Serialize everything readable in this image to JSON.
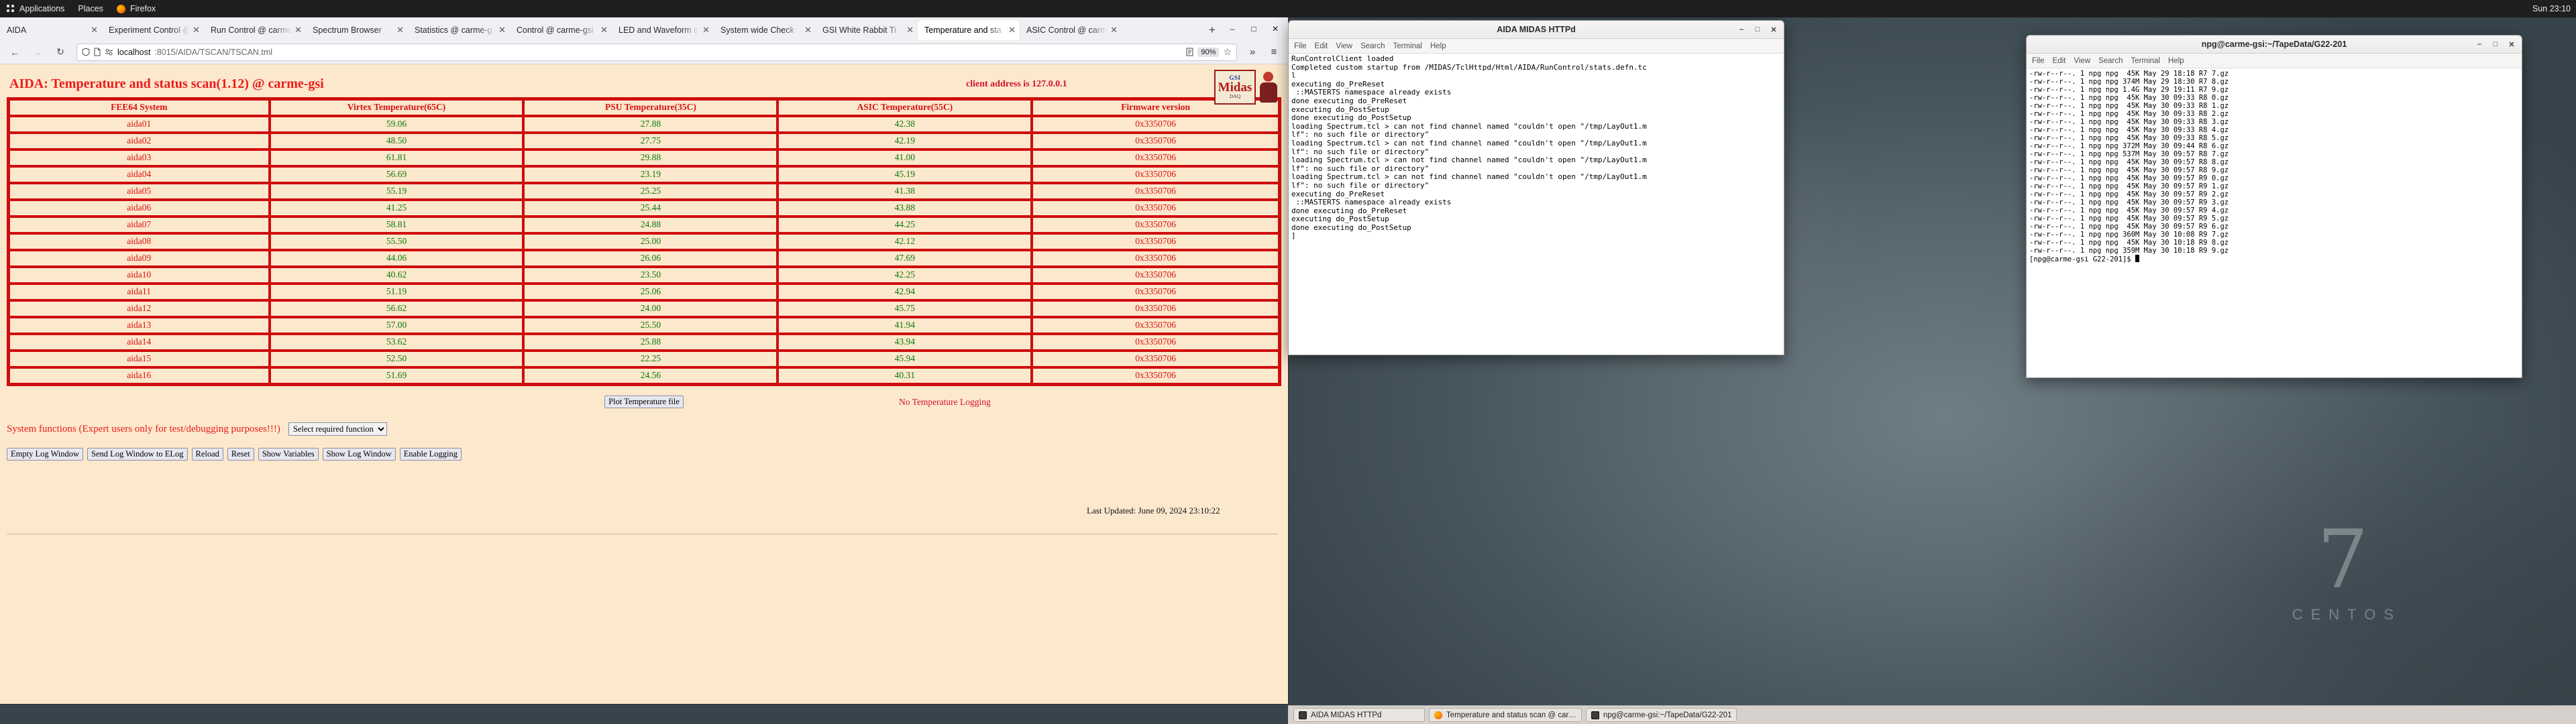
{
  "top_panel": {
    "activities_label": "Applications",
    "places_label": "Places",
    "app_name": "Firefox",
    "clock": "Sun 23:10"
  },
  "browser": {
    "tabs": [
      {
        "label": "AIDA",
        "active": false
      },
      {
        "label": "Experiment Control @",
        "active": false
      },
      {
        "label": "Run Control @ carme",
        "active": false
      },
      {
        "label": "Spectrum Browser",
        "active": false
      },
      {
        "label": "Statistics @ carme-g",
        "active": false
      },
      {
        "label": "Control @ carme-gsi",
        "active": false
      },
      {
        "label": "LED and Waveform c",
        "active": false
      },
      {
        "label": "System wide Check",
        "active": false
      },
      {
        "label": "GSI White Rabbit Ti",
        "active": false
      },
      {
        "label": "Temperature and sta",
        "active": true
      },
      {
        "label": "ASIC Control @ carm",
        "active": false
      }
    ],
    "tab_close_glyph": "✕",
    "newtab_glyph": "+",
    "window_controls": {
      "minimize": "–",
      "maximize": "□",
      "close": "✕"
    },
    "nav": {
      "back": "←",
      "forward": "→",
      "reload": "↻"
    },
    "url": {
      "shield_icon": "shield",
      "page_icon": "page",
      "perm_icon": "permissions",
      "host": "localhost",
      "path": ":8015/AIDA/TSCAN/TSCAN.tml",
      "reader_icon": "reader-view",
      "zoom_level": "90%",
      "bookmark_icon": "☆"
    },
    "overflow_glyph": "»",
    "menu_glyph": "≡"
  },
  "page": {
    "title": "AIDA: Temperature and status scan(1.12) @ carme-gsi",
    "client_address": "client address is 127.0.0.1",
    "logo": {
      "top": "GSI",
      "mid": "Midas",
      "bot": "DAQ"
    },
    "table": {
      "headers": [
        "FEE64 System",
        "Virtex Temperature(65C)",
        "PSU Temperature(35C)",
        "ASIC Temperature(55C)",
        "Firmware version"
      ],
      "rows": [
        [
          "aida01",
          "59.06",
          "27.88",
          "42.38",
          "0x3350706"
        ],
        [
          "aida02",
          "48.50",
          "27.75",
          "42.19",
          "0x3350706"
        ],
        [
          "aida03",
          "61.81",
          "29.88",
          "41.00",
          "0x3350706"
        ],
        [
          "aida04",
          "56.69",
          "23.19",
          "45.19",
          "0x3350706"
        ],
        [
          "aida05",
          "55.19",
          "25.25",
          "41.38",
          "0x3350706"
        ],
        [
          "aida06",
          "41.25",
          "25.44",
          "43.88",
          "0x3350706"
        ],
        [
          "aida07",
          "58.81",
          "24.88",
          "44.25",
          "0x3350706"
        ],
        [
          "aida08",
          "55.50",
          "25.00",
          "42.12",
          "0x3350706"
        ],
        [
          "aida09",
          "44.06",
          "26.06",
          "47.69",
          "0x3350706"
        ],
        [
          "aida10",
          "40.62",
          "23.50",
          "42.25",
          "0x3350706"
        ],
        [
          "aida11",
          "51.19",
          "25.06",
          "42.94",
          "0x3350706"
        ],
        [
          "aida12",
          "56.62",
          "24.00",
          "45.75",
          "0x3350706"
        ],
        [
          "aida13",
          "57.00",
          "25.50",
          "41.94",
          "0x3350706"
        ],
        [
          "aida14",
          "53.62",
          "25.88",
          "43.94",
          "0x3350706"
        ],
        [
          "aida15",
          "52.50",
          "22.25",
          "45.94",
          "0x3350706"
        ],
        [
          "aida16",
          "51.69",
          "24.56",
          "40.31",
          "0x3350706"
        ]
      ]
    },
    "plot_button": "Plot Temperature file",
    "no_logging": "No Temperature Logging",
    "system_functions_label": "System functions (Expert users only for test/debugging purposes!!!)",
    "select_function": "Select required function",
    "buttons": [
      "Empty Log Window",
      "Send Log Window to ELog",
      "Reload",
      "Reset",
      "Show Variables",
      "Show Log Window",
      "Enable Logging"
    ],
    "last_updated": "Last Updated: June 09, 2024 23:10:22"
  },
  "midas_terminal": {
    "title": "AIDA MIDAS HTTPd",
    "menu": [
      "File",
      "Edit",
      "View",
      "Search",
      "Terminal",
      "Help"
    ],
    "controls": {
      "minimize": "–",
      "maximize": "□",
      "close": "✕"
    },
    "lines": [
      "RunControlClient loaded",
      "Completed custom startup from /MIDAS/TclHttpd/Html/AIDA/RunControl/stats.defn.tc",
      "l",
      "executing do_PreReset",
      " ::MASTERTS namespace already exists",
      "done executing do_PreReset",
      "executing do_PostSetup",
      "done executing do_PostSetup",
      "loading Spectrum.tcl > can not find channel named \"couldn't open \"/tmp/LayOut1.m",
      "lf\": no such file or directory\"",
      "loading Spectrum.tcl > can not find channel named \"couldn't open \"/tmp/LayOut1.m",
      "lf\": no such file or directory\"",
      "loading Spectrum.tcl > can not find channel named \"couldn't open \"/tmp/LayOut1.m",
      "lf\": no such file or directory\"",
      "loading Spectrum.tcl > can not find channel named \"couldn't open \"/tmp/LayOut1.m",
      "lf\": no such file or directory\"",
      "executing do_PreReset",
      " ::MASTERTS namespace already exists",
      "done executing do_PreReset",
      "executing do_PostSetup",
      "done executing do_PostSetup",
      "]"
    ]
  },
  "tape_terminal": {
    "title": "npg@carme-gsi:~/TapeData/G22-201",
    "menu": [
      "File",
      "Edit",
      "View",
      "Search",
      "Terminal",
      "Help"
    ],
    "controls": {
      "minimize": "–",
      "maximize": "□",
      "close": "✕"
    },
    "lines": [
      "-rw-r--r--. 1 npg npg  45K May 29 18:18 R7 7.gz",
      "-rw-r--r--. 1 npg npg 374M May 29 18:30 R7 8.gz",
      "-rw-r--r--. 1 npg npg 1.4G May 29 19:11 R7 9.gz",
      "-rw-r--r--. 1 npg npg  45K May 30 09:33 R8 0.gz",
      "-rw-r--r--. 1 npg npg  45K May 30 09:33 R8 1.gz",
      "-rw-r--r--. 1 npg npg  45K May 30 09:33 R8 2.gz",
      "-rw-r--r--. 1 npg npg  45K May 30 09:33 R8 3.gz",
      "-rw-r--r--. 1 npg npg  45K May 30 09:33 R8 4.gz",
      "-rw-r--r--. 1 npg npg  45K May 30 09:33 R8 5.gz",
      "-rw-r--r--. 1 npg npg 372M May 30 09:44 R8 6.gz",
      "-rw-r--r--. 1 npg npg 537M May 30 09:57 R8 7.gz",
      "-rw-r--r--. 1 npg npg  45K May 30 09:57 R8 8.gz",
      "-rw-r--r--. 1 npg npg  45K May 30 09:57 R8 9.gz",
      "-rw-r--r--. 1 npg npg  45K May 30 09:57 R9 0.gz",
      "-rw-r--r--. 1 npg npg  45K May 30 09:57 R9 1.gz",
      "-rw-r--r--. 1 npg npg  45K May 30 09:57 R9 2.gz",
      "-rw-r--r--. 1 npg npg  45K May 30 09:57 R9 3.gz",
      "-rw-r--r--. 1 npg npg  45K May 30 09:57 R9 4.gz",
      "-rw-r--r--. 1 npg npg  45K May 30 09:57 R9 5.gz",
      "-rw-r--r--. 1 npg npg  45K May 30 09:57 R9 6.gz",
      "-rw-r--r--. 1 npg npg 360M May 30 10:08 R9 7.gz",
      "-rw-r--r--. 1 npg npg  45K May 30 10:18 R9 8.gz",
      "-rw-r--r--. 1 npg npg 359M May 30 10:18 R9 9.gz"
    ],
    "prompt": "[npg@carme-gsi G22-201]$ "
  },
  "taskbar": {
    "items": [
      {
        "label": "AIDA MIDAS HTTPd",
        "icon": "terminal-icon"
      },
      {
        "label": "Temperature and status scan @ car…",
        "icon": "firefox-icon"
      },
      {
        "label": "npg@carme-gsi:~/TapeData/G22-201",
        "icon": "terminal-icon"
      }
    ]
  },
  "desktop": {
    "logo_glyph": "7",
    "logo_word": "CENTOS"
  }
}
